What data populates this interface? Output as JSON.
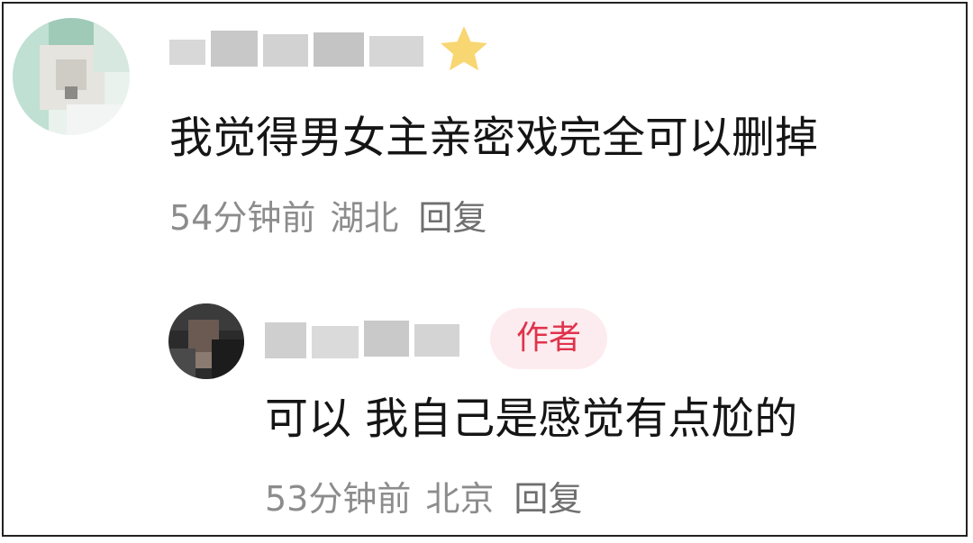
{
  "comments": [
    {
      "text": "我觉得男女主亲密戏完全可以删掉",
      "time": "54分钟前",
      "location": "湖北",
      "reply_label": "回复"
    },
    {
      "badge": "作者",
      "text": "可以 我自己是感觉有点尬的",
      "time": "53分钟前",
      "location": "北京",
      "reply_label": "回复"
    }
  ],
  "colors": {
    "primary_text": "#151515",
    "meta_text": "#8c8c8c",
    "badge_text": "#e0334c",
    "badge_bg": "#fdecef",
    "star": "#f5c842"
  },
  "icons": {
    "star": "star-icon"
  }
}
